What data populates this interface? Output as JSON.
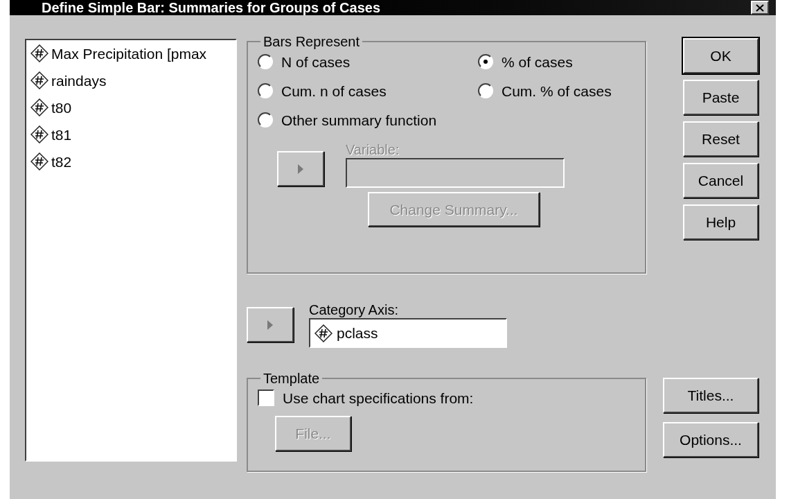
{
  "window": {
    "title": "Define Simple Bar: Summaries for Groups of Cases"
  },
  "variables": [
    {
      "name": "Max Precipitation [pmax"
    },
    {
      "name": "raindays"
    },
    {
      "name": "t80"
    },
    {
      "name": "t81"
    },
    {
      "name": "t82"
    }
  ],
  "bars_represent": {
    "label": "Bars Represent",
    "options": [
      {
        "label": "N of cases",
        "selected": false
      },
      {
        "label": "% of cases",
        "selected": true
      },
      {
        "label": "Cum. n of cases",
        "selected": false
      },
      {
        "label": "Cum. % of cases",
        "selected": false
      },
      {
        "label": "Other summary function",
        "selected": false
      }
    ],
    "variable": {
      "label": "Variable:",
      "disabled": true
    },
    "change_summary": {
      "label": "Change Summary...",
      "disabled": true
    }
  },
  "category_axis": {
    "label": "Category Axis:",
    "value": "pclass"
  },
  "template": {
    "label": "Template",
    "checkbox": {
      "label": "Use chart specifications from:",
      "checked": false
    },
    "file_button": {
      "label": "File...",
      "disabled": true
    }
  },
  "buttons": [
    {
      "label": "OK",
      "default": true
    },
    {
      "label": "Paste",
      "default": false
    },
    {
      "label": "Reset",
      "default": false
    },
    {
      "label": "Cancel",
      "default": false
    },
    {
      "label": "Help",
      "default": false
    }
  ],
  "side_buttons": [
    {
      "label": "Titles..."
    },
    {
      "label": "Options..."
    }
  ]
}
